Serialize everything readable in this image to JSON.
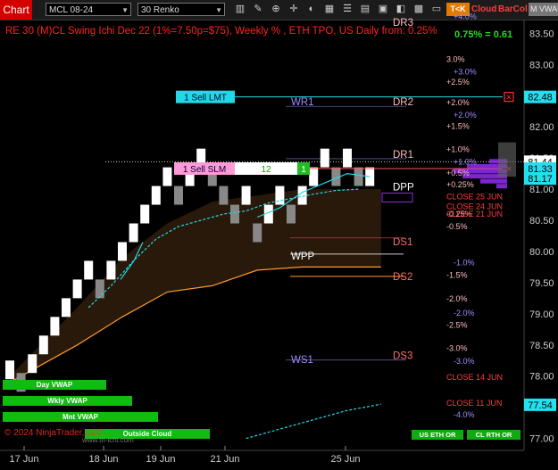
{
  "toolbar": {
    "chart_label": "Chart",
    "symbol": "MCL 08-24",
    "bar_type": "30 Renko",
    "tk_label": "T<K",
    "cloud_label": "Cloud",
    "barcol_label": "BarCol",
    "mvwap_label": "M VWAP"
  },
  "title": "RE 30 (M)CL Swing Ichi Dec 22  (1%=7.50p=$75), Weekly % , ETH TPO, US Daily from: 0.25%",
  "percent_change": "0.75% = 0.61",
  "colors": {
    "up_bar": "#ffffff",
    "down_bar": "#888888",
    "cloud": "#2a1a0c",
    "cyan": "#22d8e8",
    "orange": "#ff9a2a",
    "pink": "#ffaaff"
  },
  "price_axis": {
    "labels": [
      "83.50",
      "83.00",
      "82.50",
      "82.00",
      "81.50",
      "81.00",
      "80.50",
      "80.00",
      "79.50",
      "79.00",
      "78.50",
      "78.00",
      "77.50",
      "77.00"
    ],
    "markers": [
      {
        "text": "82.48",
        "price": 82.48,
        "color": "#22e0f0"
      },
      {
        "text": "81.44",
        "price": 81.44,
        "color": "#ffffff"
      },
      {
        "text": "81.33",
        "price": 81.33,
        "color": "#22e0f0"
      },
      {
        "text": "81.17",
        "price": 81.17,
        "color": "#22e0f0"
      },
      {
        "text": "77.54",
        "price": 77.54,
        "color": "#22e0f0"
      }
    ]
  },
  "time_axis": [
    "17 Jun",
    "18 Jun",
    "19 Jun",
    "21 Jun",
    "25 Jun"
  ],
  "levels": {
    "daily": [
      {
        "text": "DR3",
        "price": 83.68,
        "color": "#ffbbbb"
      },
      {
        "text": "DR2",
        "price": 82.4,
        "color": "#ffbbbb"
      },
      {
        "text": "DR1",
        "price": 81.56,
        "color": "#ffbbbb"
      },
      {
        "text": "DPP",
        "price": 81.04,
        "color": "#ffffff"
      },
      {
        "text": "DS1",
        "price": 80.16,
        "color": "#ff6b6b"
      },
      {
        "text": "DS2",
        "price": 79.6,
        "color": "#ff6b6b"
      },
      {
        "text": "DS3",
        "price": 78.33,
        "color": "#ff6b6b"
      }
    ],
    "weekly": [
      {
        "text": "WR1",
        "price": 82.4,
        "color": "#9c8cff"
      },
      {
        "text": "WPP",
        "price": 79.93,
        "color": "#ffffff"
      },
      {
        "text": "WS1",
        "price": 78.27,
        "color": "#9c8cff"
      }
    ]
  },
  "percent_levels": [
    {
      "text": "+4.0%",
      "price": 83.77,
      "color": "#9c8cff"
    },
    {
      "text": "3.0%",
      "price": 83.08,
      "color": "#ffbbbb"
    },
    {
      "text": "+3.0%",
      "price": 82.88,
      "color": "#9c8cff"
    },
    {
      "text": "+2.5%",
      "price": 82.72,
      "color": "#ffbbbb"
    },
    {
      "text": "+2.0%",
      "price": 82.39,
      "color": "#ffbbbb"
    },
    {
      "text": "+2.0%",
      "price": 82.19,
      "color": "#9c8cff"
    },
    {
      "text": "+1.5%",
      "price": 82.01,
      "color": "#ffbbbb"
    },
    {
      "text": "+1.0%",
      "price": 81.64,
      "color": "#ffbbbb"
    },
    {
      "text": "+1.0%",
      "price": 81.44,
      "color": "#9c8cff"
    },
    {
      "text": "+0.5%",
      "price": 81.26,
      "color": "#ffbbbb"
    },
    {
      "text": "+0.25%",
      "price": 81.07,
      "color": "#ffbbbb"
    },
    {
      "text": "-0.25%",
      "price": 80.6,
      "color": "#ffbbbb"
    },
    {
      "text": "-0.5%",
      "price": 80.4,
      "color": "#ffbbbb"
    },
    {
      "text": "-1.0%",
      "price": 79.82,
      "color": "#9c8cff"
    },
    {
      "text": "-1.5%",
      "price": 79.62,
      "color": "#ffbbbb"
    },
    {
      "text": "-2.0%",
      "price": 79.24,
      "color": "#ffbbbb"
    },
    {
      "text": "-2.0%",
      "price": 79.01,
      "color": "#9c8cff"
    },
    {
      "text": "-2.5%",
      "price": 78.82,
      "color": "#ffbbbb"
    },
    {
      "text": "-3.0%",
      "price": 78.45,
      "color": "#ffbbbb"
    },
    {
      "text": "-3.0%",
      "price": 78.24,
      "color": "#9c8cff"
    },
    {
      "text": "-4.0%",
      "price": 77.38,
      "color": "#9c8cff"
    }
  ],
  "close_labels": [
    {
      "text": "CLOSE 25 JUN",
      "price": 80.88
    },
    {
      "text": "CLOSE 24 JUN",
      "price": 80.72
    },
    {
      "text": "CLOSE 21 JUN",
      "price": 80.6
    },
    {
      "text": "CLOSE 14 JUN",
      "price": 77.98
    },
    {
      "text": "CLOSE 11 JUN",
      "price": 77.57
    }
  ],
  "orders": [
    {
      "label": "1 Sell LMT",
      "price": 82.48,
      "side": "sell"
    },
    {
      "label": "1 Sell SLM",
      "price": 81.33,
      "side": "sell",
      "qty_box": "12",
      "qty": "1"
    }
  ],
  "indicators": {
    "day_vwap": "Day VWAP",
    "wkly_vwap": "Wkly VWAP",
    "mnt_vwap": "Mnt VWAP",
    "outside_cloud": "Outside Cloud"
  },
  "footer": {
    "copyright": "© 2024 NinjaTrader, LLC",
    "url": "www.tri-ichi.com",
    "us_eth": "US ETH OR",
    "cl_rth": "CL RTH OR"
  },
  "chart_data": {
    "type": "renko",
    "brick_size": 0.3,
    "ylim": [
      76.88,
      83.72
    ],
    "bricks": [
      [
        0,
        77.95,
        78.25,
        "up"
      ],
      [
        1,
        77.75,
        78.05,
        "down"
      ],
      [
        2,
        78.05,
        78.35,
        "up"
      ],
      [
        3,
        78.35,
        78.65,
        "up"
      ],
      [
        4,
        78.65,
        78.95,
        "up"
      ],
      [
        5,
        78.95,
        79.25,
        "up"
      ],
      [
        6,
        79.25,
        79.55,
        "up"
      ],
      [
        7,
        79.55,
        79.85,
        "up"
      ],
      [
        8,
        79.25,
        79.55,
        "down"
      ],
      [
        9,
        79.55,
        79.85,
        "up"
      ],
      [
        10,
        79.85,
        80.15,
        "up"
      ],
      [
        11,
        80.15,
        80.45,
        "up"
      ],
      [
        12,
        80.45,
        80.75,
        "up"
      ],
      [
        13,
        80.75,
        81.05,
        "up"
      ],
      [
        14,
        81.05,
        81.35,
        "up"
      ],
      [
        15,
        80.75,
        81.05,
        "down"
      ],
      [
        16,
        81.05,
        81.35,
        "up"
      ],
      [
        17,
        81.35,
        81.65,
        "up"
      ],
      [
        18,
        81.05,
        81.35,
        "down"
      ],
      [
        19,
        80.75,
        81.05,
        "down"
      ],
      [
        20,
        80.45,
        80.75,
        "down"
      ],
      [
        21,
        80.75,
        81.05,
        "up"
      ],
      [
        22,
        80.15,
        80.45,
        "down"
      ],
      [
        23,
        80.45,
        80.75,
        "up"
      ],
      [
        24,
        80.75,
        81.05,
        "up"
      ],
      [
        25,
        80.45,
        80.75,
        "down"
      ],
      [
        26,
        80.75,
        81.05,
        "up"
      ],
      [
        27,
        81.05,
        81.35,
        "up"
      ],
      [
        28,
        81.35,
        81.65,
        "up"
      ],
      [
        29,
        81.05,
        81.35,
        "down"
      ],
      [
        30,
        81.35,
        81.65,
        "up"
      ],
      [
        31,
        81.05,
        81.35,
        "down"
      ],
      [
        32,
        81.05,
        81.35,
        "up"
      ]
    ],
    "tenkan": [
      [
        22,
        80.55
      ],
      [
        24,
        80.7
      ],
      [
        26,
        80.95
      ],
      [
        28,
        81.1
      ],
      [
        30,
        81.25
      ],
      [
        32,
        81.2
      ]
    ],
    "kijun": [
      [
        7,
        79.1
      ],
      [
        9,
        79.45
      ],
      [
        11,
        79.85
      ],
      [
        13,
        80.2
      ],
      [
        15,
        80.4
      ],
      [
        17,
        80.5
      ],
      [
        19,
        80.6
      ],
      [
        21,
        80.65
      ],
      [
        23,
        80.78
      ],
      [
        25,
        80.85
      ],
      [
        27,
        80.92
      ],
      [
        29,
        80.98
      ],
      [
        31,
        81.0
      ]
    ],
    "cloud_top": [
      [
        0,
        78.0
      ],
      [
        6,
        79.1
      ],
      [
        10,
        79.9
      ],
      [
        14,
        80.45
      ],
      [
        18,
        80.8
      ],
      [
        22,
        80.9
      ],
      [
        26,
        81.0
      ],
      [
        30,
        81.0
      ],
      [
        33,
        81.0
      ]
    ],
    "cloud_bottom": [
      [
        0,
        77.9
      ],
      [
        6,
        78.5
      ],
      [
        10,
        78.95
      ],
      [
        14,
        79.35
      ],
      [
        18,
        79.45
      ],
      [
        22,
        79.7
      ],
      [
        26,
        79.75
      ],
      [
        30,
        79.75
      ],
      [
        33,
        79.75
      ]
    ],
    "cyan_bottom": [
      [
        21,
        77.0
      ],
      [
        24,
        77.15
      ],
      [
        27,
        77.3
      ],
      [
        30,
        77.45
      ],
      [
        33,
        77.55
      ]
    ]
  }
}
